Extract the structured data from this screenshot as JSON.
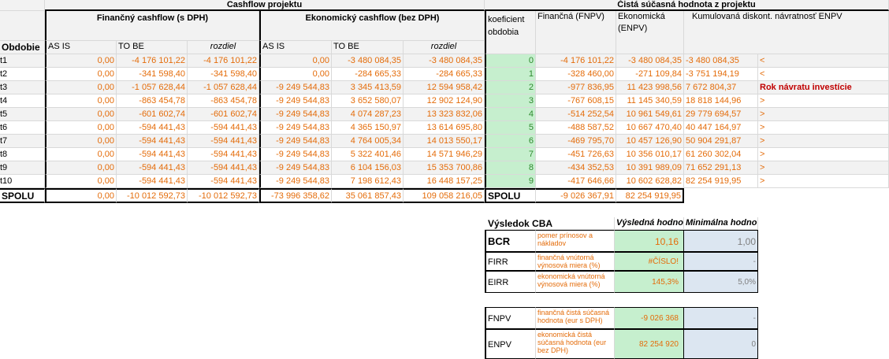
{
  "headers": {
    "cashflow_projektu": "Cashflow projektu",
    "cista_sucasna": "Čistá súčasná hodnota z projektu",
    "financny": "Finančný cashflow (s DPH)",
    "ekonomicky": "Ekonomický cashflow (bez DPH)",
    "obdobie": "Obdobie",
    "koeficient": "koeficient obdobia",
    "fnpv": "Finančná (FNPV)",
    "enpv": "Ekonomická (ENPV)",
    "kumulovana": "Kumulovaná diskont. návratnosť ENPV",
    "as_is": "AS IS",
    "to_be": "TO BE",
    "rozdiel": "rozdiel"
  },
  "rows": [
    {
      "period": "t1",
      "f_asis": "0,00",
      "f_tobe": "-4 176 101,22",
      "f_diff": "-4 176 101,22",
      "e_asis": "0,00",
      "e_tobe": "-3 480 084,35",
      "e_diff": "-3 480 084,35",
      "k": "0",
      "fnpv": "-4 176 101,22",
      "enpv": "-3 480 084,35",
      "kum": "-3 480 084,35",
      "flag": "<"
    },
    {
      "period": "t2",
      "f_asis": "0,00",
      "f_tobe": "-341 598,40",
      "f_diff": "-341 598,40",
      "e_asis": "0,00",
      "e_tobe": "-284 665,33",
      "e_diff": "-284 665,33",
      "k": "1",
      "fnpv": "-328 460,00",
      "enpv": "-271 109,84",
      "kum": "-3 751 194,19",
      "flag": "<"
    },
    {
      "period": "t3",
      "f_asis": "0,00",
      "f_tobe": "-1 057 628,44",
      "f_diff": "-1 057 628,44",
      "e_asis": "-9 249 544,83",
      "e_tobe": "3 345 413,59",
      "e_diff": "12 594 958,42",
      "k": "2",
      "fnpv": "-977 836,95",
      "enpv": "11 423 998,56",
      "kum": "7 672 804,37",
      "flag": "Rok návratu investície"
    },
    {
      "period": "t4",
      "f_asis": "0,00",
      "f_tobe": "-863 454,78",
      "f_diff": "-863 454,78",
      "e_asis": "-9 249 544,83",
      "e_tobe": "3 652 580,07",
      "e_diff": "12 902 124,90",
      "k": "3",
      "fnpv": "-767 608,15",
      "enpv": "11 145 340,59",
      "kum": "18 818 144,96",
      "flag": ">"
    },
    {
      "period": "t5",
      "f_asis": "0,00",
      "f_tobe": "-601 602,74",
      "f_diff": "-601 602,74",
      "e_asis": "-9 249 544,83",
      "e_tobe": "4 074 287,23",
      "e_diff": "13 323 832,06",
      "k": "4",
      "fnpv": "-514 252,54",
      "enpv": "10 961 549,61",
      "kum": "29 779 694,57",
      "flag": ">"
    },
    {
      "period": "t6",
      "f_asis": "0,00",
      "f_tobe": "-594 441,43",
      "f_diff": "-594 441,43",
      "e_asis": "-9 249 544,83",
      "e_tobe": "4 365 150,97",
      "e_diff": "13 614 695,80",
      "k": "5",
      "fnpv": "-488 587,52",
      "enpv": "10 667 470,40",
      "kum": "40 447 164,97",
      "flag": ">"
    },
    {
      "period": "t7",
      "f_asis": "0,00",
      "f_tobe": "-594 441,43",
      "f_diff": "-594 441,43",
      "e_asis": "-9 249 544,83",
      "e_tobe": "4 764 005,34",
      "e_diff": "14 013 550,17",
      "k": "6",
      "fnpv": "-469 795,70",
      "enpv": "10 457 126,90",
      "kum": "50 904 291,87",
      "flag": ">"
    },
    {
      "period": "t8",
      "f_asis": "0,00",
      "f_tobe": "-594 441,43",
      "f_diff": "-594 441,43",
      "e_asis": "-9 249 544,83",
      "e_tobe": "5 322 401,46",
      "e_diff": "14 571 946,29",
      "k": "7",
      "fnpv": "-451 726,63",
      "enpv": "10 356 010,17",
      "kum": "61 260 302,04",
      "flag": ">"
    },
    {
      "period": "t9",
      "f_asis": "0,00",
      "f_tobe": "-594 441,43",
      "f_diff": "-594 441,43",
      "e_asis": "-9 249 544,83",
      "e_tobe": "6 104 156,03",
      "e_diff": "15 353 700,86",
      "k": "8",
      "fnpv": "-434 352,53",
      "enpv": "10 391 989,09",
      "kum": "71 652 291,13",
      "flag": ">"
    },
    {
      "period": "t10",
      "f_asis": "0,00",
      "f_tobe": "-594 441,43",
      "f_diff": "-594 441,43",
      "e_asis": "-9 249 544,83",
      "e_tobe": "7 198 612,43",
      "e_diff": "16 448 157,25",
      "k": "9",
      "fnpv": "-417 646,66",
      "enpv": "10 602 628,82",
      "kum": "82 254 919,95",
      "flag": ">"
    }
  ],
  "total": {
    "label": "SPOLU",
    "f_asis": "0,00",
    "f_tobe": "-10 012 592,73",
    "f_diff": "-10 012 592,73",
    "e_asis": "-73 996 358,62",
    "e_tobe": "35 061 857,43",
    "e_diff": "109 058 216,05",
    "label2": "SPOLU",
    "fnpv": "-9 026 367,91",
    "enpv": "82 254 919,95"
  },
  "cba": {
    "title": "Výsledok CBA",
    "col_result": "Výsledná hodnota",
    "col_min": "Minimálna hodnota",
    "items": [
      {
        "name": "BCR",
        "desc": "pomer prínosov a nákladov",
        "value": "10,16",
        "min": "1,00"
      },
      {
        "name": "FIRR",
        "desc": "finančná vnútorná výnosová miera (%)",
        "value": "#ČÍSLO!",
        "min": "-"
      },
      {
        "name": "EIRR",
        "desc": "ekonomická vnútorná výnosová miera (%)",
        "value": "145,3%",
        "min": "5,0%"
      },
      {
        "name": "FNPV",
        "desc": "finančná čistá súčasná hodnota (eur s DPH)",
        "value": "-9 026 368",
        "min": "-"
      },
      {
        "name": "ENPV",
        "desc": "ekonomická čistá súčasná hodnota (eur bez DPH)",
        "value": "82 254 920",
        "min": "0"
      }
    ]
  }
}
